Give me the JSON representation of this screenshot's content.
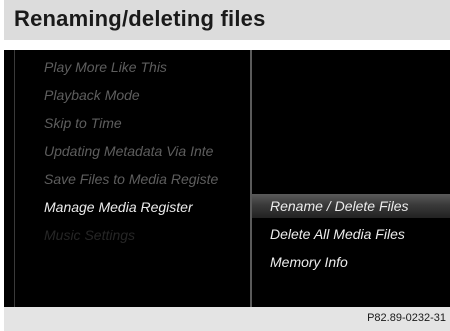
{
  "page": {
    "heading": "Renaming/deleting files",
    "figure_code": "P82.89-0232-31"
  },
  "menu": {
    "items": [
      {
        "label": "Play More Like This"
      },
      {
        "label": "Playback Mode"
      },
      {
        "label": "Skip to Time"
      },
      {
        "label": "Updating Metadata Via Inte"
      },
      {
        "label": "Save Files to Media Registe"
      },
      {
        "label": "Manage Media Register",
        "state": "selected"
      },
      {
        "label": "Music Settings"
      }
    ]
  },
  "submenu": {
    "items": [
      {
        "label": "Rename / Delete Files",
        "state": "highlighted"
      },
      {
        "label": "Delete All Media Files"
      },
      {
        "label": "Memory Info"
      }
    ]
  },
  "colors": {
    "screen_background": "#000000",
    "heading_bar": "#dcdcdc",
    "disabled_text": "#5e5e5e",
    "active_text": "#ececec"
  }
}
